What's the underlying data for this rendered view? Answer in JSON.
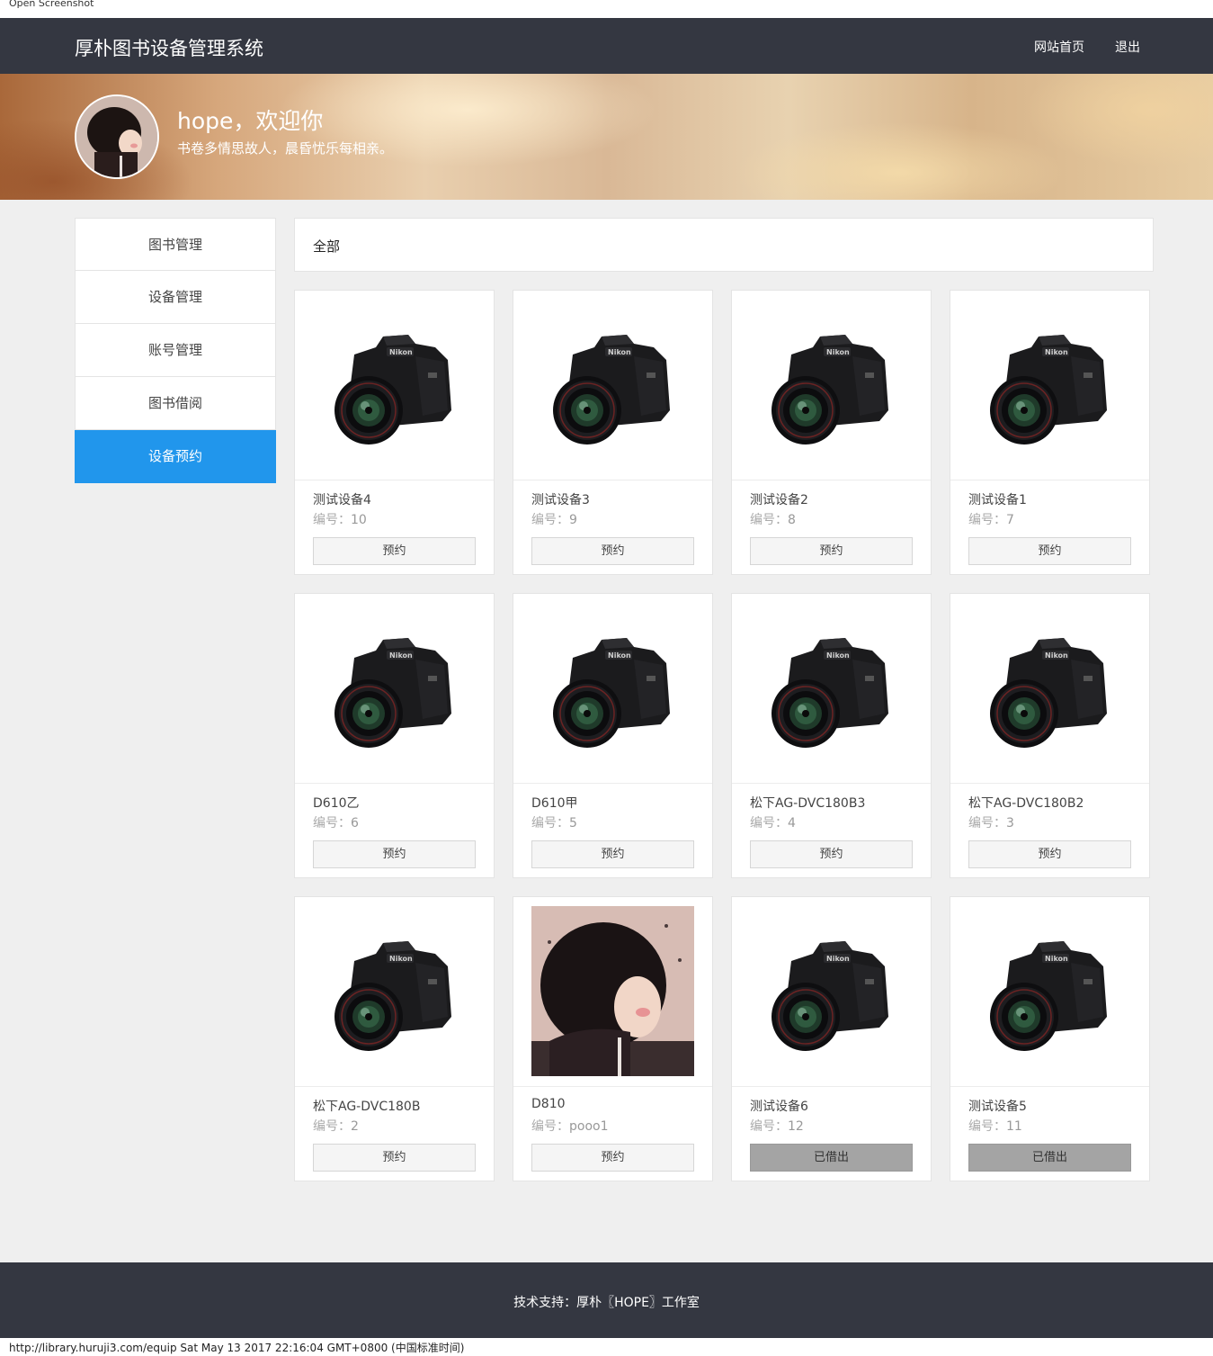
{
  "window": {
    "caption": "Open Screenshot"
  },
  "navbar": {
    "brand": "厚朴图书设备管理系统",
    "home_link": "网站首页",
    "logout_link": "退出"
  },
  "banner": {
    "welcome": "hope，欢迎你",
    "motto": "书卷多情思故人，晨昏忧乐每相亲。"
  },
  "sidebar": {
    "items": [
      {
        "label": "图书管理"
      },
      {
        "label": "设备管理"
      },
      {
        "label": "账号管理"
      },
      {
        "label": "图书借阅"
      },
      {
        "label": "设备预约"
      }
    ],
    "active": "设备预约"
  },
  "filter": {
    "label": "全部"
  },
  "code_prefix": "编号：",
  "devices": [
    {
      "name": "测试设备4",
      "code": "10",
      "button": "预约",
      "status": "available",
      "image": "camera"
    },
    {
      "name": "测试设备3",
      "code": "9",
      "button": "预约",
      "status": "available",
      "image": "camera"
    },
    {
      "name": "测试设备2",
      "code": "8",
      "button": "预约",
      "status": "available",
      "image": "camera"
    },
    {
      "name": "测试设备1",
      "code": "7",
      "button": "预约",
      "status": "available",
      "image": "camera"
    },
    {
      "name": "D610乙",
      "code": "6",
      "button": "预约",
      "status": "available",
      "image": "camera"
    },
    {
      "name": "D610甲",
      "code": "5",
      "button": "预约",
      "status": "available",
      "image": "camera"
    },
    {
      "name": "松下AG-DVC180B3",
      "code": "4",
      "button": "预约",
      "status": "available",
      "image": "camera"
    },
    {
      "name": "松下AG-DVC180B2",
      "code": "3",
      "button": "预约",
      "status": "available",
      "image": "camera"
    },
    {
      "name": "松下AG-DVC180B",
      "code": "2",
      "button": "预约",
      "status": "available",
      "image": "camera"
    },
    {
      "name": "D810",
      "code": "pooo1",
      "button": "预约",
      "status": "available",
      "image": "portrait"
    },
    {
      "name": "测试设备6",
      "code": "12",
      "button": "已借出",
      "status": "borrowed",
      "image": "camera"
    },
    {
      "name": "测试设备5",
      "code": "11",
      "button": "已借出",
      "status": "borrowed",
      "image": "camera"
    }
  ],
  "footer": {
    "text": "技术支持：厚朴〖HOPE〗工作室"
  },
  "statusbar": {
    "text": "http://library.huruji3.com/equip Sat May 13 2017 22:16:04 GMT+0800 (中国标准时间)"
  },
  "colors": {
    "navbar": "#343741",
    "active_menu": "#2196ec",
    "borrowed_button": "#a4a4a4"
  }
}
